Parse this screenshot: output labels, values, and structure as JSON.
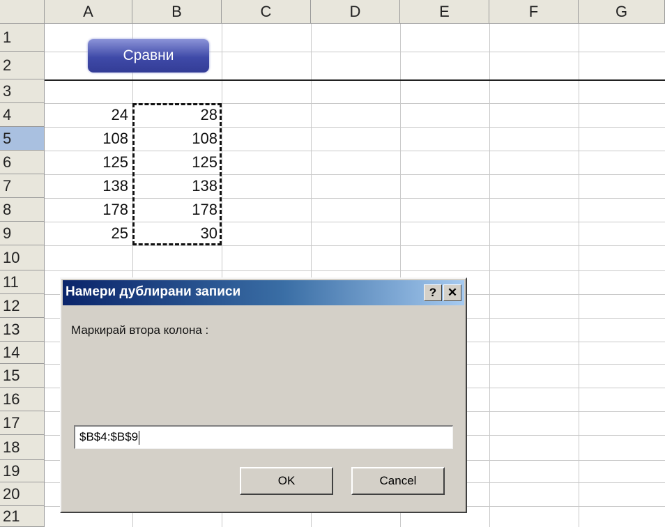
{
  "sheet": {
    "columns": [
      "A",
      "B",
      "C",
      "D",
      "E",
      "F",
      "G"
    ],
    "rows": [
      "1",
      "2",
      "3",
      "4",
      "5",
      "6",
      "7",
      "8",
      "9",
      "10",
      "11",
      "12",
      "13",
      "14",
      "15",
      "16",
      "17",
      "18",
      "19",
      "20",
      "21"
    ],
    "selected_row": "5",
    "column_a": [
      "24",
      "108",
      "125",
      "138",
      "178",
      "25"
    ],
    "column_b": [
      "28",
      "108",
      "125",
      "138",
      "178",
      "30"
    ]
  },
  "sheet_button": {
    "label": "Сравни"
  },
  "dialog": {
    "title": "Намери дублирани записи",
    "help_label": "?",
    "close_label": "✕",
    "prompt": "Маркирай втора колона :",
    "ref_value": "$B$4:$B$9",
    "ok_label": "OK",
    "cancel_label": "Cancel"
  }
}
